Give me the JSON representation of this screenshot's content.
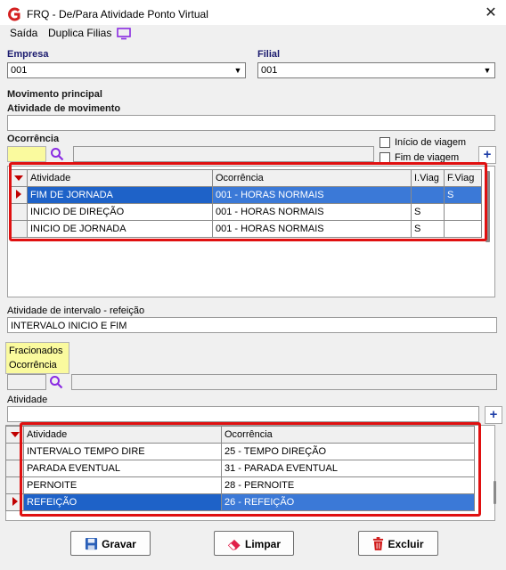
{
  "window": {
    "title": "FRQ - De/Para Atividade Ponto Virtual"
  },
  "menu": {
    "saida": "Saída",
    "duplica": "Duplica Filias"
  },
  "empresa": {
    "label": "Empresa",
    "value": "001"
  },
  "filial": {
    "label": "Filial",
    "value": "001"
  },
  "movimento": {
    "heading": "Movimento principal",
    "atividade_label": "Atividade de movimento",
    "atividade_value": "",
    "ocorrencia_label": "Ocorrência",
    "inicio_viagem": "Início de viagem",
    "fim_viagem": "Fim de viagem"
  },
  "grid1": {
    "headers": [
      "Atividade",
      "Ocorrência",
      "I.Viag",
      "F.Viag"
    ],
    "rows": [
      [
        "FIM DE JORNADA",
        "001 - HORAS NORMAIS",
        "",
        "S"
      ],
      [
        "INICIO DE DIREÇÃO",
        "001 - HORAS NORMAIS",
        "S",
        ""
      ],
      [
        "INICIO DE JORNADA",
        "001 - HORAS NORMAIS",
        "S",
        ""
      ]
    ]
  },
  "intervalo": {
    "label": "Atividade de intervalo - refeição",
    "value": "INTERVALO INICIO E FIM"
  },
  "fracionados": {
    "line1": "Fracionados",
    "line2": "Ocorrência",
    "atividade_label": "Atividade"
  },
  "grid2": {
    "headers": [
      "Atividade",
      "Ocorrência"
    ],
    "rows": [
      [
        "INTERVALO TEMPO DIRE",
        "25 - TEMPO DIREÇÃO"
      ],
      [
        "PARADA EVENTUAL",
        "31 - PARADA EVENTUAL"
      ],
      [
        "PERNOITE",
        "28 - PERNOITE"
      ],
      [
        "REFEIÇÃO",
        "26 - REFEIÇÃO"
      ]
    ]
  },
  "buttons": {
    "gravar": "Gravar",
    "limpar": "Limpar",
    "excluir": "Excluir"
  },
  "colors": {
    "selection": "#3b79d7",
    "highlight_box": "#e01010",
    "field_yellow": "#fafa9e"
  }
}
